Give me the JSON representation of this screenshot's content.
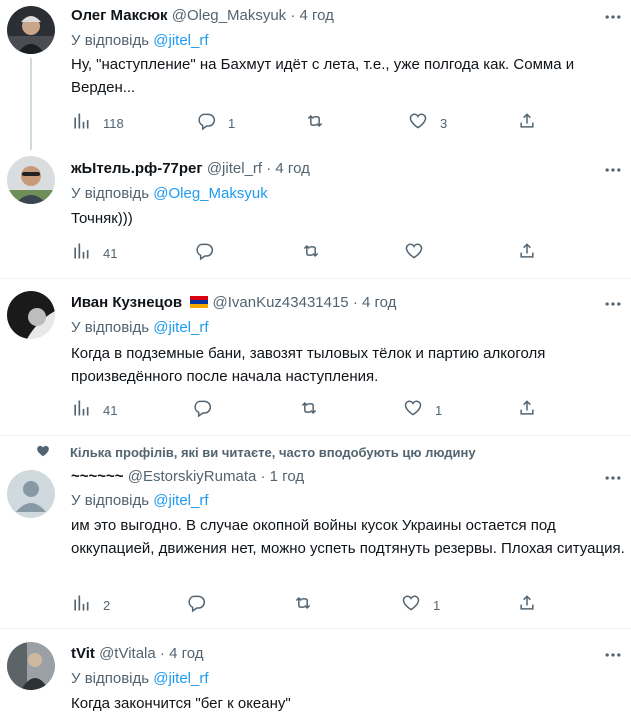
{
  "tweets": [
    {
      "name": "Олег Максюк",
      "handle": "@Oleg_Maksyuk",
      "dot": "·",
      "time": "4 год",
      "reply_prefix": "У відповідь",
      "reply_to": "@jitel_rf",
      "text": "Ну, \"наступление\" на Бахмут идёт с лета, т.е., уже полгода как. Сомма и Верден...",
      "views": "118",
      "replies": "1",
      "retweets": "",
      "likes": "3"
    },
    {
      "name": "жЫтель.рф-77рег",
      "handle": "@jitel_rf",
      "dot": "·",
      "time": "4 год",
      "reply_prefix": "У відповідь",
      "reply_to": "@Oleg_Maksyuk",
      "text": "Точняк)))",
      "views": "41",
      "replies": "",
      "retweets": "",
      "likes": ""
    },
    {
      "name": "Иван Кузнецов",
      "handle": "@IvanKuz43431415",
      "dot": "·",
      "time": "4 год",
      "reply_prefix": "У відповідь",
      "reply_to": "@jitel_rf",
      "text": "Когда в подземные бани, завозят тыловых тёлок и партию алкоголя произведённого после начала наступления.",
      "views": "41",
      "replies": "",
      "retweets": "",
      "likes": "1"
    },
    {
      "social_context": "Кілька профілів, які ви читаєте, часто вподобують цю людину",
      "name": "~~~~~~",
      "handle": "@EstorskiyRumata",
      "dot": "·",
      "time": "1 год",
      "reply_prefix": "У відповідь",
      "reply_to": "@jitel_rf",
      "text": "им это выгодно. В случае окопной войны кусок Украины остается под оккупацией, движения нет, можно успеть подтянуть резервы. Плохая ситуация.",
      "views": "2",
      "replies": "",
      "retweets": "",
      "likes": "1"
    },
    {
      "name": "tVit",
      "handle": "@tVitala",
      "dot": "·",
      "time": "4 год",
      "reply_prefix": "У відповідь",
      "reply_to": "@jitel_rf",
      "text": "Когда закончится \"бег к океану\""
    }
  ],
  "colors": {
    "accent": "#1d9bf0",
    "secondary": "#536471",
    "divider": "#eff3f4"
  },
  "icons": [
    "views-icon",
    "reply-icon",
    "retweet-icon",
    "like-icon",
    "share-icon",
    "more-icon",
    "heart-icon",
    "armenia-flag-icon"
  ]
}
